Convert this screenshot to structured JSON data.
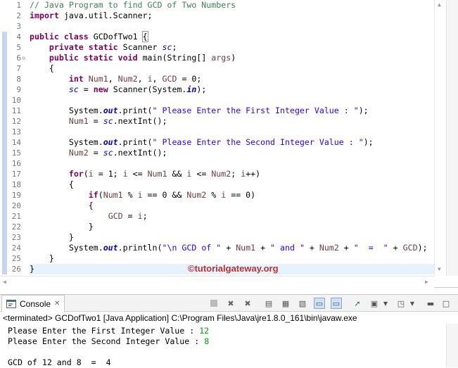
{
  "editor": {
    "line_numbers": [
      "1",
      "2",
      "3",
      "4",
      "5",
      "6",
      "7",
      "8",
      "9",
      "10",
      "11",
      "12",
      "13",
      "14",
      "15",
      "16",
      "17",
      "18",
      "19",
      "20",
      "21",
      "22",
      "23",
      "24",
      "25",
      "26"
    ],
    "lines": [
      [
        {
          "c": "cm",
          "t": "// Java Program to find GCD of Two Numbers"
        }
      ],
      [
        {
          "c": "kw",
          "t": "import"
        },
        {
          "c": "",
          "t": " java.util.Scanner;"
        }
      ],
      [],
      [
        {
          "c": "kw",
          "t": "public"
        },
        {
          "c": "",
          "t": " "
        },
        {
          "c": "kw",
          "t": "class"
        },
        {
          "c": "",
          "t": " GCDofTwo1 "
        },
        {
          "c": "brk",
          "t": "{"
        }
      ],
      [
        {
          "c": "",
          "t": "    "
        },
        {
          "c": "kw",
          "t": "private"
        },
        {
          "c": "",
          "t": " "
        },
        {
          "c": "kw",
          "t": "static"
        },
        {
          "c": "",
          "t": " Scanner "
        },
        {
          "c": "fi",
          "t": "sc"
        },
        {
          "c": "",
          "t": ";"
        }
      ],
      [
        {
          "c": "",
          "t": "    "
        },
        {
          "c": "kw",
          "t": "public"
        },
        {
          "c": "",
          "t": " "
        },
        {
          "c": "kw",
          "t": "static"
        },
        {
          "c": "",
          "t": " "
        },
        {
          "c": "kw",
          "t": "void"
        },
        {
          "c": "",
          "t": " main(String[] "
        },
        {
          "c": "vr",
          "t": "args"
        },
        {
          "c": "",
          "t": ")"
        }
      ],
      [
        {
          "c": "",
          "t": "    {"
        }
      ],
      [
        {
          "c": "",
          "t": "        "
        },
        {
          "c": "kw",
          "t": "int"
        },
        {
          "c": "",
          "t": " "
        },
        {
          "c": "vr",
          "t": "Num1"
        },
        {
          "c": "",
          "t": ", "
        },
        {
          "c": "vr",
          "t": "Num2"
        },
        {
          "c": "",
          "t": ", "
        },
        {
          "c": "vr",
          "t": "i"
        },
        {
          "c": "",
          "t": ", "
        },
        {
          "c": "vr",
          "t": "GCD"
        },
        {
          "c": "",
          "t": " = 0;"
        }
      ],
      [
        {
          "c": "",
          "t": "        "
        },
        {
          "c": "fi",
          "t": "sc"
        },
        {
          "c": "",
          "t": " = "
        },
        {
          "c": "kw",
          "t": "new"
        },
        {
          "c": "",
          "t": " Scanner(System."
        },
        {
          "c": "sf",
          "t": "in"
        },
        {
          "c": "",
          "t": ");"
        }
      ],
      [],
      [
        {
          "c": "",
          "t": "        System."
        },
        {
          "c": "sf",
          "t": "out"
        },
        {
          "c": "",
          "t": ".print("
        },
        {
          "c": "st",
          "t": "\" Please Enter the First Integer Value : \""
        },
        {
          "c": "",
          "t": ");"
        }
      ],
      [
        {
          "c": "",
          "t": "        "
        },
        {
          "c": "vr",
          "t": "Num1"
        },
        {
          "c": "",
          "t": " = "
        },
        {
          "c": "fi",
          "t": "sc"
        },
        {
          "c": "",
          "t": ".nextInt();"
        }
      ],
      [],
      [
        {
          "c": "",
          "t": "        System."
        },
        {
          "c": "sf",
          "t": "out"
        },
        {
          "c": "",
          "t": ".print("
        },
        {
          "c": "st",
          "t": "\" Please Enter the Second Integer Value : \""
        },
        {
          "c": "",
          "t": ");"
        }
      ],
      [
        {
          "c": "",
          "t": "        "
        },
        {
          "c": "vr",
          "t": "Num2"
        },
        {
          "c": "",
          "t": " = "
        },
        {
          "c": "fi",
          "t": "sc"
        },
        {
          "c": "",
          "t": ".nextInt();"
        }
      ],
      [],
      [
        {
          "c": "",
          "t": "        "
        },
        {
          "c": "kw",
          "t": "for"
        },
        {
          "c": "",
          "t": "("
        },
        {
          "c": "vr",
          "t": "i"
        },
        {
          "c": "",
          "t": " = 1; "
        },
        {
          "c": "vr",
          "t": "i"
        },
        {
          "c": "",
          "t": " <= "
        },
        {
          "c": "vr",
          "t": "Num1"
        },
        {
          "c": "",
          "t": " && "
        },
        {
          "c": "vr",
          "t": "i"
        },
        {
          "c": "",
          "t": " <= "
        },
        {
          "c": "vr",
          "t": "Num2"
        },
        {
          "c": "",
          "t": "; "
        },
        {
          "c": "vr",
          "t": "i"
        },
        {
          "c": "",
          "t": "++)"
        }
      ],
      [
        {
          "c": "",
          "t": "        {"
        }
      ],
      [
        {
          "c": "",
          "t": "            "
        },
        {
          "c": "kw",
          "t": "if"
        },
        {
          "c": "",
          "t": "("
        },
        {
          "c": "vr",
          "t": "Num1"
        },
        {
          "c": "",
          "t": " % "
        },
        {
          "c": "vr",
          "t": "i"
        },
        {
          "c": "",
          "t": " == 0 && "
        },
        {
          "c": "vr",
          "t": "Num2"
        },
        {
          "c": "",
          "t": " % "
        },
        {
          "c": "vr",
          "t": "i"
        },
        {
          "c": "",
          "t": " == 0)"
        }
      ],
      [
        {
          "c": "",
          "t": "            {"
        }
      ],
      [
        {
          "c": "",
          "t": "                "
        },
        {
          "c": "vr",
          "t": "GCD"
        },
        {
          "c": "",
          "t": " = "
        },
        {
          "c": "vr",
          "t": "i"
        },
        {
          "c": "",
          "t": ";"
        }
      ],
      [
        {
          "c": "",
          "t": "            }"
        }
      ],
      [
        {
          "c": "",
          "t": "        }"
        }
      ],
      [
        {
          "c": "",
          "t": "        System."
        },
        {
          "c": "sf",
          "t": "out"
        },
        {
          "c": "",
          "t": ".println("
        },
        {
          "c": "st",
          "t": "\"\\n GCD of \""
        },
        {
          "c": "",
          "t": " + "
        },
        {
          "c": "vr",
          "t": "Num1"
        },
        {
          "c": "",
          "t": " + "
        },
        {
          "c": "st",
          "t": "\" and \""
        },
        {
          "c": "",
          "t": " + "
        },
        {
          "c": "vr",
          "t": "Num2"
        },
        {
          "c": "",
          "t": " + "
        },
        {
          "c": "st",
          "t": "\"  =  \""
        },
        {
          "c": "",
          "t": " + "
        },
        {
          "c": "vr",
          "t": "GCD"
        },
        {
          "c": "",
          "t": ");"
        }
      ],
      [
        {
          "c": "",
          "t": "    }"
        }
      ],
      [
        {
          "c": "",
          "t": "}"
        }
      ]
    ],
    "watermark": "©tutorialgateway.org",
    "highlight_line": 26,
    "fold_line": 6
  },
  "console": {
    "tab_label": "Console",
    "tab_close": "✕",
    "terminated": "<terminated> GCDofTwo1 [Java Application] C:\\Program Files\\Java\\jre1.8.0_161\\bin\\javaw.exe",
    "output": [
      [
        {
          "c": "",
          "t": " Please Enter the First Integer Value : "
        },
        {
          "c": "inp",
          "t": "12"
        }
      ],
      [
        {
          "c": "",
          "t": " Please Enter the Second Integer Value : "
        },
        {
          "c": "inp",
          "t": "8"
        }
      ],
      [],
      [
        {
          "c": "",
          "t": " GCD of 12 and 8  =  4"
        }
      ]
    ]
  },
  "colors": {
    "keyword": "#7f0055",
    "comment": "#3f7f5f",
    "string": "#2a00ff",
    "field": "#0000c0",
    "input": "#00a000",
    "watermark": "#b8312f"
  }
}
